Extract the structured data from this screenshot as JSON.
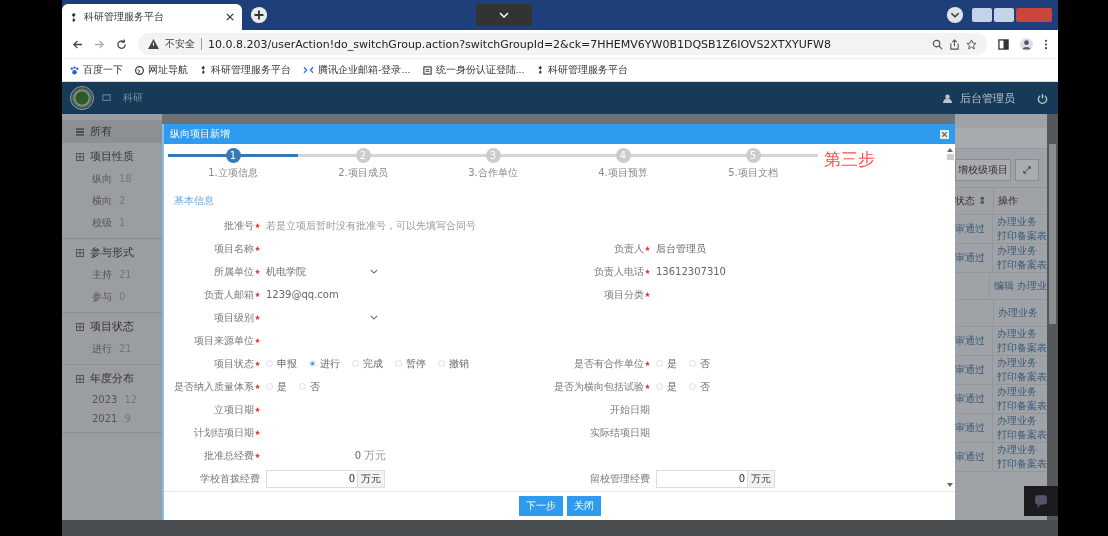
{
  "browser": {
    "tab_title": "科研管理服务平台",
    "url_warning": "不安全",
    "url": "10.0.8.203/userAction!do_switchGroup.action?switchGroupId=2&ck=7HHEMV6YW0B1DQSB1Z6IOVS2XTXYUFW8",
    "bookmarks": [
      {
        "label": "百度一下",
        "kind": "paw"
      },
      {
        "label": "网址导航",
        "kind": "globe"
      },
      {
        "label": "科研管理服务平台",
        "kind": "logo"
      },
      {
        "label": "腾讯企业邮箱-登录...",
        "kind": "mail"
      },
      {
        "label": "统一身份认证登陆...",
        "kind": "page"
      },
      {
        "label": "科研管理服务平台",
        "kind": "logo"
      }
    ]
  },
  "app": {
    "nav_items": [
      "科研"
    ],
    "user": "后台管理员"
  },
  "sidebar": {
    "all": "所有",
    "groups": [
      {
        "title": "项目性质",
        "items": [
          {
            "label": "纵向",
            "count": "18"
          },
          {
            "label": "横向",
            "count": "2"
          },
          {
            "label": "校级",
            "count": "1"
          }
        ]
      },
      {
        "title": "参与形式",
        "items": [
          {
            "label": "主持",
            "count": "21"
          },
          {
            "label": "参与",
            "count": "0"
          }
        ]
      },
      {
        "title": "项目状态",
        "items": [
          {
            "label": "进行",
            "count": "21"
          }
        ]
      },
      {
        "title": "年度分布",
        "items": [
          {
            "label": "2023",
            "count": "12"
          },
          {
            "label": "2021",
            "count": "9"
          }
        ]
      }
    ]
  },
  "table": {
    "button": "增校级项目",
    "columns": [
      "状态 ⇕",
      "操作"
    ],
    "rows": [
      {
        "status": "审通过",
        "actions": [
          "办理业务",
          "打印备案表"
        ]
      },
      {
        "status": "审通过",
        "actions": [
          "办理业务",
          "打印备案表"
        ]
      },
      {
        "status": "",
        "actions": [
          "编辑 办理业"
        ]
      },
      {
        "status": "",
        "actions": [
          "办理业务"
        ]
      },
      {
        "status": "审通过",
        "actions": [
          "办理业务",
          "打印备案表"
        ]
      },
      {
        "status": "审通过",
        "actions": [
          "办理业务",
          "打印备案表"
        ]
      },
      {
        "status": "审通过",
        "actions": [
          "办理业务",
          "打印备案表"
        ]
      },
      {
        "status": "审通过",
        "actions": [
          "办理业务",
          "打印备案表"
        ]
      },
      {
        "status": "审通过",
        "actions": [
          "办理业务",
          "打印备案表"
        ]
      }
    ]
  },
  "dialog": {
    "title": "纵向项目新增",
    "steps": [
      {
        "number": "1",
        "label": "1.立项信息",
        "active": true
      },
      {
        "number": "2",
        "label": "2.项目成员",
        "active": false
      },
      {
        "number": "3",
        "label": "3.合作单位",
        "active": false
      },
      {
        "number": "4",
        "label": "4.项目预算",
        "active": false
      },
      {
        "number": "5",
        "label": "5.项目文档",
        "active": false
      }
    ],
    "annotation": "第三步",
    "section": "基本信息",
    "rows": [
      {
        "fields": [
          {
            "label": "批准号",
            "required": true,
            "kind": "text",
            "placeholder": "若是立项后暂时没有批准号，可以先填写合同号"
          }
        ]
      },
      {
        "fields": [
          {
            "label": "项目名称",
            "required": true,
            "kind": "text"
          },
          {
            "label": "负责人",
            "required": true,
            "kind": "text",
            "value": "后台管理员"
          }
        ]
      },
      {
        "fields": [
          {
            "label": "所属单位",
            "required": true,
            "kind": "select",
            "value": "机电学院"
          },
          {
            "label": "负责人电话",
            "required": true,
            "kind": "text",
            "value": "13612307310"
          }
        ]
      },
      {
        "fields": [
          {
            "label": "负责人邮箱",
            "required": true,
            "kind": "text",
            "value": "1239@qq.com"
          },
          {
            "label": "项目分类",
            "required": true,
            "kind": "text"
          }
        ]
      },
      {
        "fields": [
          {
            "label": "项目级别",
            "required": true,
            "kind": "select"
          }
        ]
      },
      {
        "fields": [
          {
            "label": "项目来源单位",
            "required": true,
            "kind": "text"
          }
        ]
      },
      {
        "fields": [
          {
            "label": "项目状态",
            "required": true,
            "kind": "radio",
            "options": [
              {
                "label": "申报",
                "selected": false
              },
              {
                "label": "进行",
                "selected": true
              },
              {
                "label": "完成",
                "selected": false
              },
              {
                "label": "暂停",
                "selected": false
              },
              {
                "label": "撤销",
                "selected": false
              }
            ]
          },
          {
            "label": "是否有合作单位",
            "required": true,
            "kind": "radio",
            "options": [
              {
                "label": "是",
                "selected": false
              },
              {
                "label": "否",
                "selected": false
              }
            ]
          }
        ]
      },
      {
        "fields": [
          {
            "label": "是否纳入质量体系",
            "required": true,
            "kind": "radio",
            "options": [
              {
                "label": "是",
                "selected": false
              },
              {
                "label": "否",
                "selected": false
              }
            ]
          },
          {
            "label": "是否为横向包括试验",
            "required": true,
            "kind": "radio",
            "options": [
              {
                "label": "是",
                "selected": false
              },
              {
                "label": "否",
                "selected": false
              }
            ]
          }
        ]
      },
      {
        "fields": [
          {
            "label": "立项日期",
            "required": true,
            "kind": "text"
          },
          {
            "label": "开始日期",
            "required": false,
            "kind": "text"
          }
        ]
      },
      {
        "fields": [
          {
            "label": "计划结项日期",
            "required": true,
            "kind": "text"
          },
          {
            "label": "实际结项日期",
            "required": false,
            "kind": "text"
          }
        ]
      },
      {
        "fields": [
          {
            "label": "批准总经费",
            "required": true,
            "kind": "amount",
            "value": "0",
            "unit": "万元"
          }
        ]
      },
      {
        "fields": [
          {
            "label": "学校首拨经费",
            "required": false,
            "kind": "amount-input",
            "value": "0",
            "unit": "万元"
          },
          {
            "label": "留校管理经费",
            "required": false,
            "kind": "amount-input",
            "value": "0",
            "unit": "万元"
          }
        ]
      }
    ],
    "buttons": [
      "下一步",
      "关闭"
    ]
  }
}
